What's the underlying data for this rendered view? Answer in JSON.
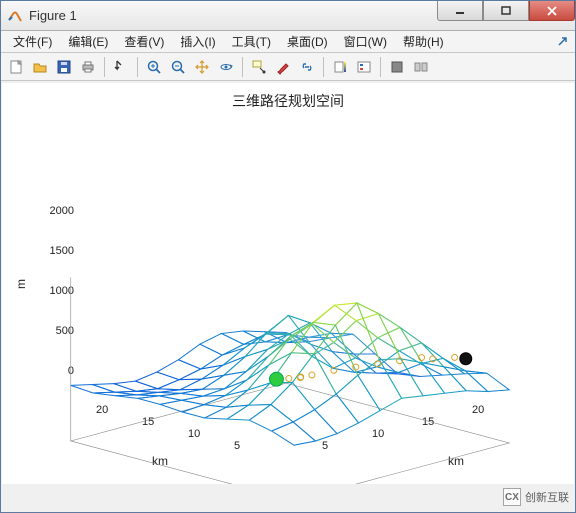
{
  "window": {
    "title": "Figure 1"
  },
  "menu": {
    "file": "文件(F)",
    "edit": "编辑(E)",
    "view": "查看(V)",
    "insert": "插入(I)",
    "tools": "工具(T)",
    "desktop": "桌面(D)",
    "window": "窗口(W)",
    "help": "帮助(H)"
  },
  "toolbar_icons": {
    "new": "new",
    "open": "open",
    "save": "save",
    "print": "print",
    "pointer": "pointer",
    "zoomin": "zoom-in",
    "zoomout": "zoom-out",
    "pan": "pan",
    "rotate3d": "rotate3d",
    "datacursor": "data-cursor",
    "brush": "brush",
    "link": "link",
    "colorbar": "insert-colorbar",
    "legend": "insert-legend",
    "hide": "hide-plot-tools",
    "show": "show-plot-tools"
  },
  "plot": {
    "title": "三维路径规划空间",
    "zlabel": "m",
    "xlabel": "km",
    "ylabel": "km",
    "zticks": [
      "0",
      "500",
      "1000",
      "1500",
      "2000"
    ],
    "xticks": [
      "5",
      "10",
      "15",
      "20"
    ],
    "yticks": [
      "5",
      "10",
      "15",
      "20"
    ]
  },
  "watermark": {
    "cx": "CX",
    "text": "创新互联"
  },
  "chart_data": {
    "type": "surface3d",
    "title": "三维路径规划空间",
    "xlabel": "km",
    "ylabel": "km",
    "zlabel": "m",
    "xlim": [
      1,
      21
    ],
    "ylim": [
      1,
      21
    ],
    "zlim": [
      0,
      2000
    ],
    "xticks": [
      5,
      10,
      15,
      20
    ],
    "yticks": [
      5,
      10,
      15,
      20
    ],
    "zticks": [
      0,
      500,
      1000,
      1500,
      2000
    ],
    "x": [
      1,
      3,
      5,
      7,
      9,
      11,
      13,
      15,
      17,
      19,
      21
    ],
    "y": [
      1,
      3,
      5,
      7,
      9,
      11,
      13,
      15,
      17,
      19,
      21
    ],
    "z": [
      [
        620,
        580,
        700,
        820,
        650,
        480,
        520,
        610,
        700,
        780,
        650
      ],
      [
        700,
        640,
        780,
        900,
        720,
        560,
        640,
        820,
        960,
        880,
        700
      ],
      [
        780,
        720,
        880,
        1100,
        820,
        640,
        780,
        1050,
        1220,
        1000,
        780
      ],
      [
        820,
        760,
        960,
        1260,
        980,
        760,
        960,
        1280,
        1480,
        1120,
        820
      ],
      [
        760,
        700,
        860,
        1120,
        1180,
        980,
        1220,
        1560,
        1720,
        1240,
        860
      ],
      [
        640,
        600,
        720,
        900,
        1060,
        1260,
        1520,
        1820,
        1920,
        1300,
        900
      ],
      [
        560,
        540,
        620,
        740,
        860,
        1120,
        1440,
        1680,
        1720,
        1180,
        820
      ],
      [
        520,
        500,
        560,
        640,
        720,
        900,
        1160,
        1380,
        1440,
        1020,
        740
      ],
      [
        560,
        540,
        600,
        660,
        700,
        780,
        920,
        1080,
        1160,
        900,
        680
      ],
      [
        620,
        600,
        640,
        700,
        720,
        740,
        780,
        880,
        960,
        820,
        660
      ],
      [
        680,
        660,
        700,
        740,
        740,
        720,
        720,
        780,
        840,
        780,
        680
      ]
    ],
    "markers": {
      "start": {
        "x": 4,
        "y": 5,
        "z": 300,
        "color": "#2ecc40",
        "note": "green sphere"
      },
      "goal": {
        "x": 20,
        "y": 4,
        "z": 1100,
        "color": "#111111",
        "note": "black sphere"
      },
      "path_nodes": [
        {
          "x": 6,
          "y": 7,
          "z": 420
        },
        {
          "x": 8,
          "y": 8,
          "z": 560
        },
        {
          "x": 10,
          "y": 9,
          "z": 680
        },
        {
          "x": 11,
          "y": 10,
          "z": 760
        },
        {
          "x": 12,
          "y": 10,
          "z": 820
        },
        {
          "x": 13,
          "y": 9,
          "z": 880
        },
        {
          "x": 14,
          "y": 8,
          "z": 920
        },
        {
          "x": 15,
          "y": 7,
          "z": 960
        },
        {
          "x": 16,
          "y": 6,
          "z": 1000
        },
        {
          "x": 17,
          "y": 5,
          "z": 1040
        },
        {
          "x": 18,
          "y": 5,
          "z": 1060
        },
        {
          "x": 19,
          "y": 4,
          "z": 1080
        }
      ]
    },
    "colormap": "parula",
    "grid": true
  }
}
